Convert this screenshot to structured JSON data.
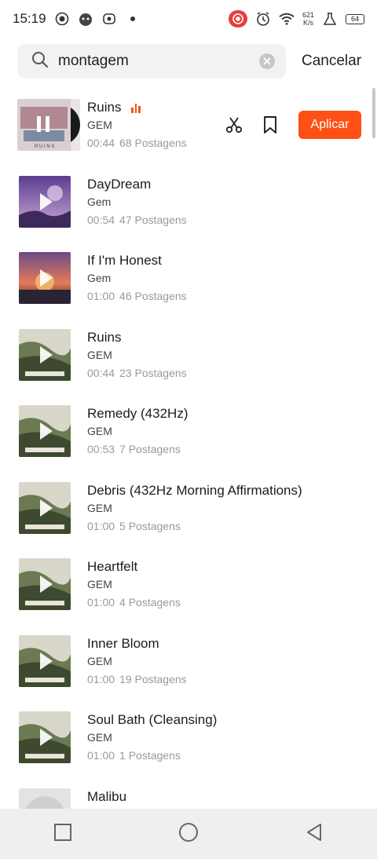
{
  "status_bar": {
    "time": "15:19",
    "net_speed_value": "621",
    "net_speed_unit": "K/s",
    "battery": "64",
    "icons": [
      "record-icon",
      "face-icon",
      "screen-record-icon",
      "dot-icon",
      "rec-badge-icon",
      "alarm-icon",
      "wifi-icon",
      "flask-icon",
      "battery-icon"
    ]
  },
  "search": {
    "query": "montagem",
    "cancel_label": "Cancelar"
  },
  "colors": {
    "accent": "#fe5014",
    "thumb_main": "#4a5a3a"
  },
  "tracks": [
    {
      "title": "Ruins",
      "artist": "GEM",
      "duration": "00:44",
      "posts": "68 Postagens",
      "playing": true
    },
    {
      "title": "DayDream",
      "artist": "Gem",
      "duration": "00:54",
      "posts": "47 Postagens"
    },
    {
      "title": "If I'm Honest",
      "artist": "Gem",
      "duration": "01:00",
      "posts": "46 Postagens"
    },
    {
      "title": "Ruins",
      "artist": "GEM",
      "duration": "00:44",
      "posts": "23 Postagens"
    },
    {
      "title": "Remedy (432Hz)",
      "artist": "GEM",
      "duration": "00:53",
      "posts": "7 Postagens"
    },
    {
      "title": "Debris (432Hz Morning Affirmations)",
      "artist": "GEM",
      "duration": "01:00",
      "posts": "5 Postagens"
    },
    {
      "title": "Heartfelt",
      "artist": "GEM",
      "duration": "01:00",
      "posts": "4 Postagens"
    },
    {
      "title": "Inner Bloom",
      "artist": "GEM",
      "duration": "01:00",
      "posts": "19 Postagens"
    },
    {
      "title": "Soul Bath (Cleansing)",
      "artist": "GEM",
      "duration": "01:00",
      "posts": "1 Postagens"
    },
    {
      "title": "Malibu",
      "artist": "",
      "duration": "",
      "posts": ""
    }
  ],
  "row_actions": {
    "apply_label": "Aplicar"
  }
}
